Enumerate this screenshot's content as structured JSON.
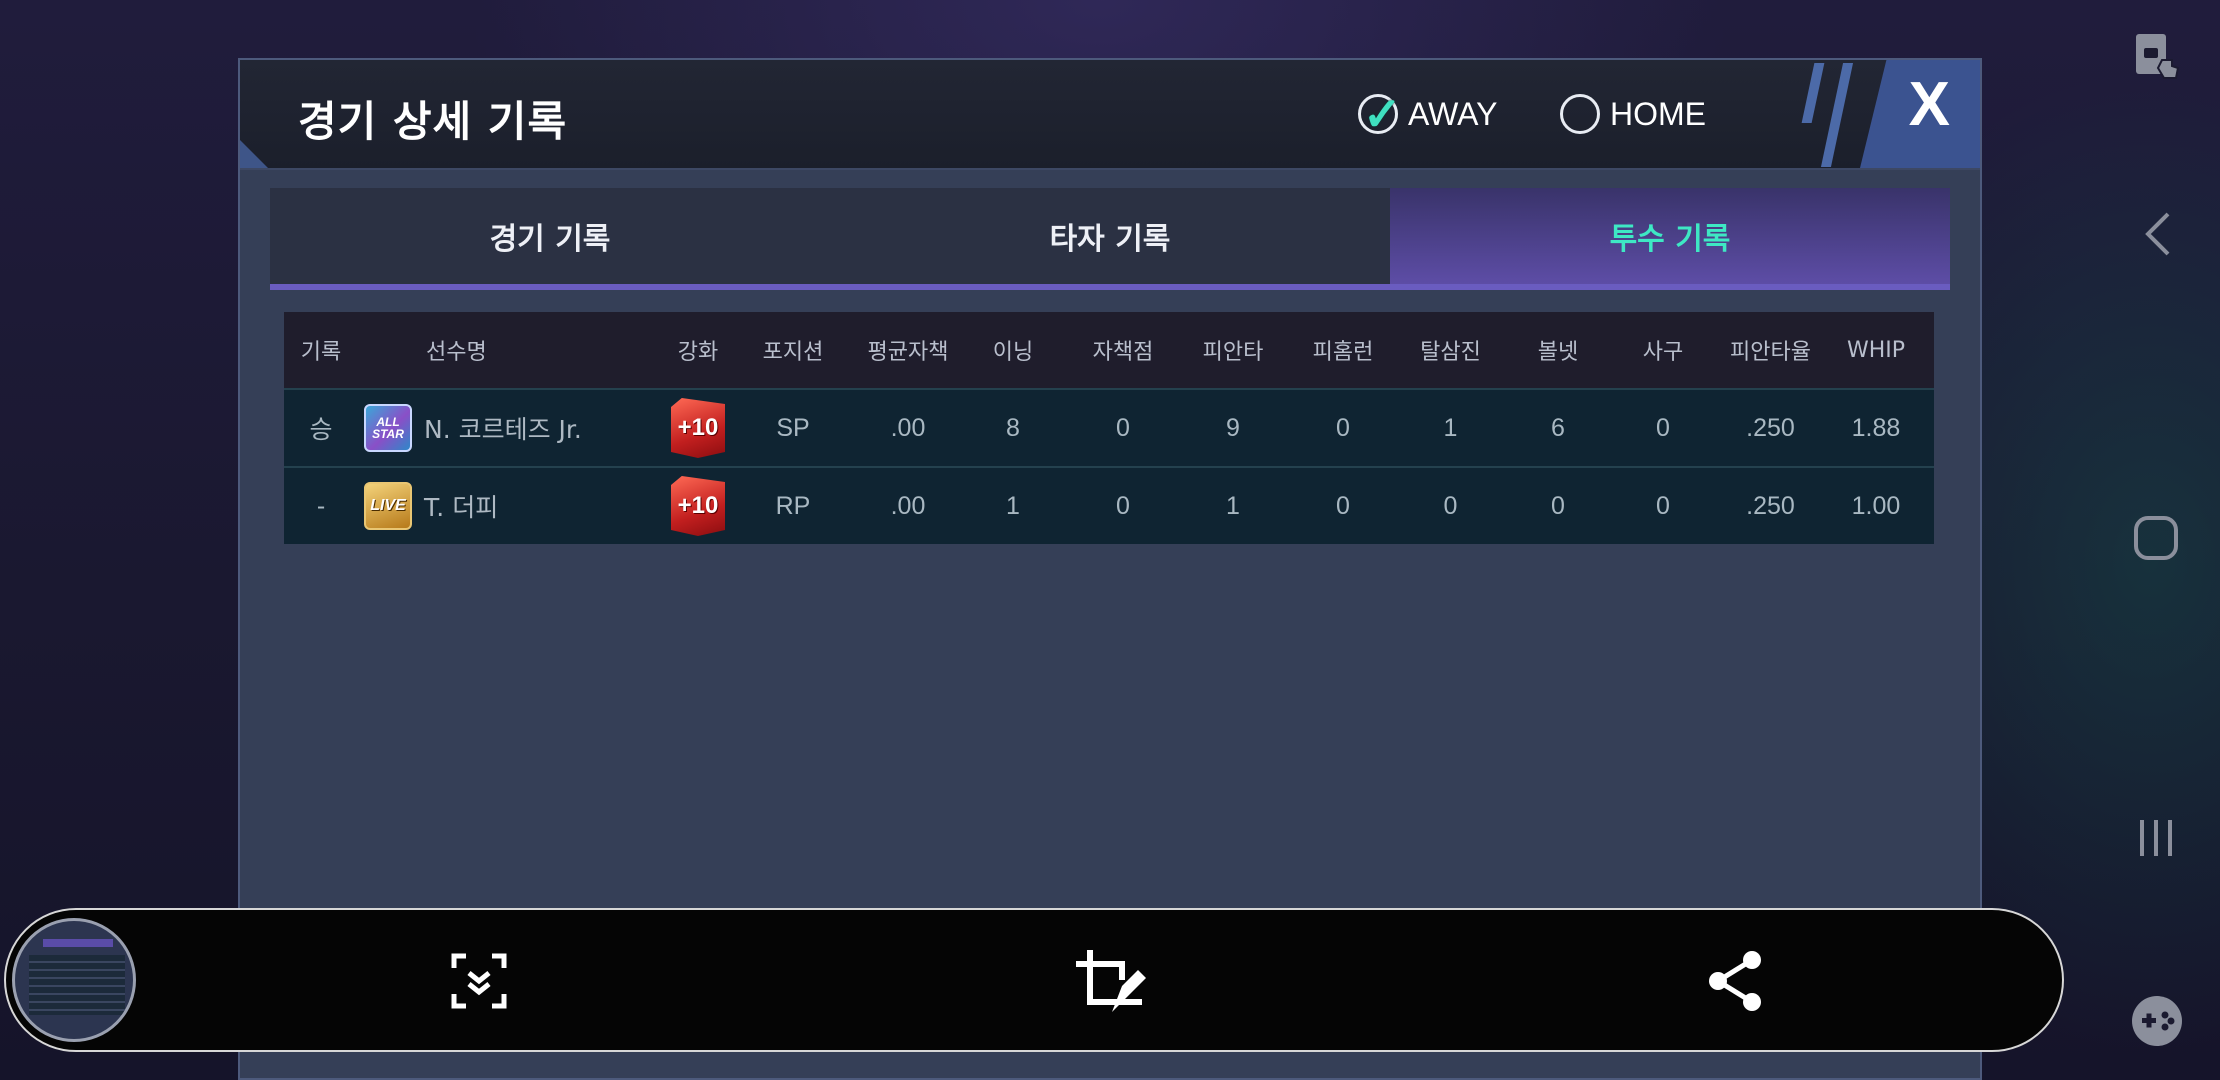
{
  "dialog": {
    "title": "경기 상세 기록",
    "toggle": {
      "away_label": "AWAY",
      "home_label": "HOME",
      "selected": "AWAY"
    },
    "close_label": "X"
  },
  "tabs": [
    {
      "label": "경기 기록",
      "active": false
    },
    {
      "label": "타자 기록",
      "active": false
    },
    {
      "label": "투수 기록",
      "active": true
    }
  ],
  "table": {
    "headers": [
      "기록",
      "선수명",
      "강화",
      "포지션",
      "평균자책",
      "이닝",
      "자책점",
      "피안타",
      "피홈런",
      "탈삼진",
      "볼넷",
      "사구",
      "피안타율",
      "WHIP"
    ],
    "rows": [
      {
        "record": "승",
        "card_type": "ALL STAR",
        "name": "N. 코르테즈 Jr.",
        "enhance": "+10",
        "position": "SP",
        "era": ".00",
        "innings": "8",
        "earned_runs": "0",
        "hits": "9",
        "home_runs": "0",
        "strikeouts": "1",
        "walks": "6",
        "hbp": "0",
        "avg_against": ".250",
        "whip": "1.88"
      },
      {
        "record": "-",
        "card_type": "LIVE",
        "name": "T. 더피",
        "enhance": "+10",
        "position": "RP",
        "era": ".00",
        "innings": "1",
        "earned_runs": "0",
        "hits": "1",
        "home_runs": "0",
        "strikeouts": "0",
        "walks": "0",
        "hbp": "0",
        "avg_against": ".250",
        "whip": "1.00"
      }
    ]
  },
  "colors": {
    "accent_teal": "#3ee8c4",
    "tab_active_purple": "#5d4da6",
    "enhance_red": "#c21f1f"
  },
  "system": {
    "side_icons": [
      "touch-lock-icon",
      "back-icon",
      "home-icon",
      "recents-icon",
      "game-tools-icon"
    ],
    "toolbar_icons": [
      "scroll-capture-icon",
      "crop-edit-icon",
      "share-icon"
    ]
  }
}
